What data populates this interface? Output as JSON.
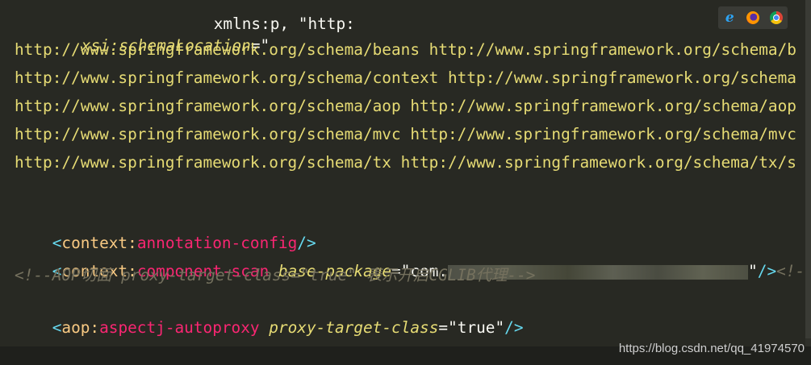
{
  "editor": {
    "line_top_partial": "xmlns:p, \"http:",
    "schema_location_attr": "xsi:schemaLocation",
    "schema_location_eq": "=",
    "schema_location_quote": "\"",
    "url_lines": [
      "http://www.springframework.org/schema/beans http://www.springframework.org/schema/b",
      "http://www.springframework.org/schema/context http://www.springframework.org/schema",
      "http://www.springframework.org/schema/aop http://www.springframework.org/schema/aop",
      "http://www.springframework.org/schema/mvc http://www.springframework.org/schema/mvc",
      "http://www.springframework.org/schema/tx http://www.springframework.org/schema/tx/s"
    ],
    "annotation_config": {
      "lt": "<",
      "ns": "context",
      "colon": ":",
      "name": "annotation-config",
      "end": "/>"
    },
    "component_scan": {
      "lt": "<",
      "ns": "context",
      "colon": ":",
      "name": "component-scan",
      "attr": "base-package",
      "eq": "=",
      "value_start": "\"com.",
      "value_end": "\"",
      "close": "/>",
      "comment_tail": "<!-- 启"
    },
    "aop_comment": "<!--AOP切面 proxy-target-class=\"true\" 表示开启CGLIB代理-->",
    "aspectj": {
      "lt": "<",
      "ns": "aop",
      "colon": ":",
      "name": "aspectj-autoproxy",
      "attr": "proxy-target-class",
      "eq": "=",
      "value": "\"true\"",
      "close": "/>"
    }
  },
  "browser_icons": [
    "ie-icon",
    "firefox-icon",
    "chrome-icon"
  ],
  "watermark": "https://blog.csdn.net/qq_41974570",
  "colors": {
    "background": "#282923",
    "string": "#e6db74",
    "tag": "#f92672",
    "bracket": "#66d9ef",
    "comment": "#75715e"
  }
}
